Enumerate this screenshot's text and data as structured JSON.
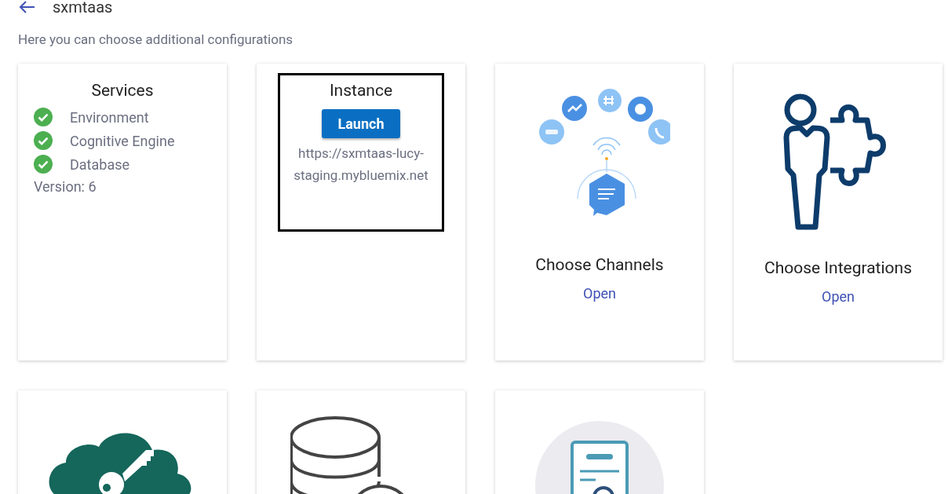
{
  "header": {
    "title": "sxmtaas"
  },
  "subtitle": "Here you can choose additional configurations",
  "cards": [
    {
      "kind": "services",
      "title": "Services",
      "items": [
        {
          "label": "Environment",
          "ok": true
        },
        {
          "label": "Cognitive Engine",
          "ok": true
        },
        {
          "label": "Database",
          "ok": true
        }
      ],
      "version": "Version: 6"
    },
    {
      "kind": "instance",
      "title": "Instance",
      "button": "Launch",
      "url": "https://sxmtaas-lucy-staging.mybluemix.net",
      "highlighted": true
    },
    {
      "kind": "channels",
      "title": "Choose Channels",
      "link": "Open"
    },
    {
      "kind": "integrations",
      "title": "Choose Integrations",
      "link": "Open"
    },
    {
      "kind": "cloud-key"
    },
    {
      "kind": "database"
    },
    {
      "kind": "certificate"
    }
  ]
}
